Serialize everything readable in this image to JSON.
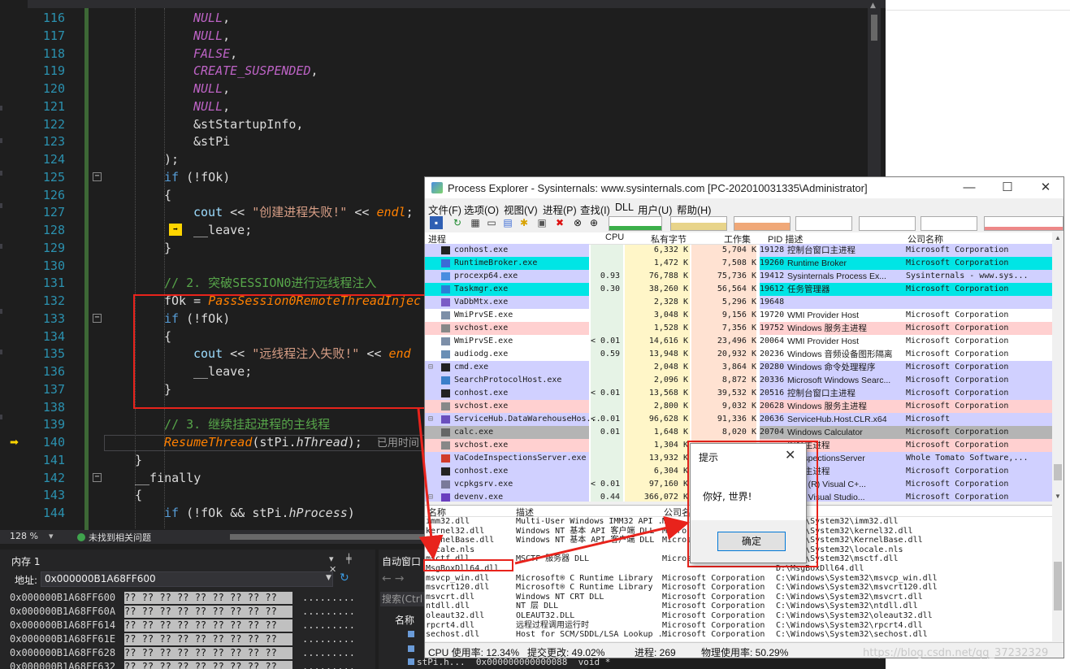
{
  "vs": {
    "lines": [
      {
        "n": "116",
        "html": "<span class='c-macro'>NULL</span>,"
      },
      {
        "n": "117",
        "html": "<span class='c-macro'>NULL</span>,"
      },
      {
        "n": "118",
        "html": "<span class='c-macro'>FALSE</span>,"
      },
      {
        "n": "119",
        "html": "<span class='c-macro'>CREATE_SUSPENDED</span>,"
      },
      {
        "n": "120",
        "html": "<span class='c-macro'>NULL</span>,"
      },
      {
        "n": "121",
        "html": "<span class='c-macro'>NULL</span>,"
      },
      {
        "n": "122",
        "html": "&amp;stStartupInfo,"
      },
      {
        "n": "123",
        "html": "&amp;stPi"
      },
      {
        "n": "124",
        "html": ");"
      },
      {
        "n": "125",
        "html": "<span class='c-kw'>if</span> (!fOk)"
      },
      {
        "n": "126",
        "html": "{"
      },
      {
        "n": "127",
        "html": "<span class='c-var'>cout</span> &lt;&lt; <span class='c-str'>\"创建进程失败!\"</span> &lt;&lt; <span class='c-fn'>endl</span>;"
      },
      {
        "n": "128",
        "html": "__leave;"
      },
      {
        "n": "129",
        "html": "}"
      },
      {
        "n": "130",
        "html": ""
      },
      {
        "n": "131",
        "html": "<span class='c-com'>// 2. 突破SESSION0进行远线程注入</span>"
      },
      {
        "n": "132",
        "html": "fOk = <span class='c-fn'>PassSession0RemoteThreadInjec</span>"
      },
      {
        "n": "133",
        "html": "<span class='c-kw'>if</span> (!fOk)"
      },
      {
        "n": "134",
        "html": "{"
      },
      {
        "n": "135",
        "html": "<span class='c-var'>cout</span> &lt;&lt; <span class='c-str'>\"远线程注入失败!\"</span> &lt;&lt; <span class='c-fn'>end</span>"
      },
      {
        "n": "136",
        "html": "__leave;"
      },
      {
        "n": "137",
        "html": "}"
      },
      {
        "n": "138",
        "html": ""
      },
      {
        "n": "139",
        "html": "<span class='c-com'>// 3. 继续挂起进程的主线程</span>"
      },
      {
        "n": "140",
        "html": "<span class='c-fn'>ResumeThread</span>(stPi.<span class='c-field'>hThread</span>);  <span class='timing'>已用时间</span>"
      },
      {
        "n": "141",
        "html": "}"
      },
      {
        "n": "142",
        "html": "__finally"
      },
      {
        "n": "143",
        "html": "{"
      },
      {
        "n": "144",
        "html": "<span class='c-kw'>if</span> (!fOk &amp;&amp; stPi.<span class='c-field'>hProcess</span>)"
      }
    ],
    "status": {
      "zoom": "128 %",
      "issues": "未找到相关问题"
    },
    "memory": {
      "title": "内存 1",
      "address_label": "地址:",
      "address": "0x000000B1A68FF600",
      "rows": [
        {
          "addr": "0x000000B1A68FF600",
          "bytes": "?? ?? ?? ?? ?? ?? ?? ?? ??",
          "ascii": "........."
        },
        {
          "addr": "0x000000B1A68FF60A",
          "bytes": "?? ?? ?? ?? ?? ?? ?? ?? ??",
          "ascii": "........."
        },
        {
          "addr": "0x000000B1A68FF614",
          "bytes": "?? ?? ?? ?? ?? ?? ?? ?? ??",
          "ascii": "........."
        },
        {
          "addr": "0x000000B1A68FF61E",
          "bytes": "?? ?? ?? ?? ?? ?? ?? ?? ??",
          "ascii": "........."
        },
        {
          "addr": "0x000000B1A68FF628",
          "bytes": "?? ?? ?? ?? ?? ?? ?? ?? ??",
          "ascii": "........."
        },
        {
          "addr": "0x000000B1A68FF632",
          "bytes": "?? ?? ?? ?? ?? ?? ?? ?? ??",
          "ascii": "........."
        }
      ]
    },
    "autos": {
      "title": "自动窗口",
      "search": "搜索(Ctrl",
      "col_name": "名称"
    },
    "debug_strip": "stPi.h...  0x000000000000088  void *"
  },
  "pe": {
    "title": "Process Explorer - Sysinternals: www.sysinternals.com [PC-202010031335\\Administrator]",
    "menu": [
      "文件(F)",
      "选项(O)",
      "视图(V)",
      "进程(P)",
      "查找(I)",
      "DLL",
      "用户(U)",
      "帮助(H)"
    ],
    "headers": {
      "process": "进程",
      "cpu": "CPU",
      "private": "私有字节",
      "working": "工作集",
      "pid_desc": "PID 描述",
      "company": "公司名称"
    },
    "rows": [
      {
        "name": "conhost.exe",
        "cpu": "",
        "priv": "6,332 K",
        "ws": "5,704 K",
        "pid": "19128",
        "desc": "控制台窗口主进程",
        "co": "Microsoft Corporation",
        "bg": "#d0d0ff",
        "tree": ""
      },
      {
        "name": "RuntimeBroker.exe",
        "cpu": "",
        "priv": "1,472 K",
        "ws": "7,508 K",
        "pid": "19260",
        "desc": "Runtime Broker",
        "co": "Microsoft Corporation",
        "bg": "#00e5e5",
        "tree": ""
      },
      {
        "name": "procexp64.exe",
        "cpu": "0.93",
        "priv": "76,788 K",
        "ws": "75,736 K",
        "pid": "19412",
        "desc": "Sysinternals Process Ex...",
        "co": "Sysinternals - www.sys...",
        "bg": "#d0d0ff",
        "tree": ""
      },
      {
        "name": "Taskmgr.exe",
        "cpu": "0.30",
        "priv": "38,260 K",
        "ws": "56,564 K",
        "pid": "19612",
        "desc": "任务管理器",
        "co": "Microsoft Corporation",
        "bg": "#00e5e5",
        "tree": ""
      },
      {
        "name": "VaDbMtx.exe",
        "cpu": "",
        "priv": "2,328 K",
        "ws": "5,296 K",
        "pid": "19648",
        "desc": "",
        "co": "",
        "bg": "#d0d0ff",
        "tree": ""
      },
      {
        "name": "WmiPrvSE.exe",
        "cpu": "",
        "priv": "3,048 K",
        "ws": "9,156 K",
        "pid": "19720",
        "desc": "WMI Provider Host",
        "co": "Microsoft Corporation",
        "bg": "#ffffff",
        "tree": ""
      },
      {
        "name": "svchost.exe",
        "cpu": "",
        "priv": "1,528 K",
        "ws": "7,356 K",
        "pid": "19752",
        "desc": "Windows 服务主进程",
        "co": "Microsoft Corporation",
        "bg": "#ffd0d0",
        "tree": ""
      },
      {
        "name": "WmiPrvSE.exe",
        "cpu": "< 0.01",
        "priv": "14,616 K",
        "ws": "23,496 K",
        "pid": "20064",
        "desc": "WMI Provider Host",
        "co": "Microsoft Corporation",
        "bg": "#ffffff",
        "tree": ""
      },
      {
        "name": "audiodg.exe",
        "cpu": "0.59",
        "priv": "13,948 K",
        "ws": "20,932 K",
        "pid": "20236",
        "desc": "Windows 音频设备图形隔离",
        "co": "Microsoft Corporation",
        "bg": "#ffffff",
        "tree": ""
      },
      {
        "name": "cmd.exe",
        "cpu": "",
        "priv": "2,048 K",
        "ws": "3,864 K",
        "pid": "20280",
        "desc": "Windows 命令处理程序",
        "co": "Microsoft Corporation",
        "bg": "#d0d0ff",
        "tree": "⊟"
      },
      {
        "name": "SearchProtocolHost.exe",
        "cpu": "",
        "priv": "2,096 K",
        "ws": "8,872 K",
        "pid": "20336",
        "desc": "Microsoft Windows Searc...",
        "co": "Microsoft Corporation",
        "bg": "#d0d0ff",
        "tree": ""
      },
      {
        "name": "conhost.exe",
        "cpu": "< 0.01",
        "priv": "13,568 K",
        "ws": "39,532 K",
        "pid": "20516",
        "desc": "控制台窗口主进程",
        "co": "Microsoft Corporation",
        "bg": "#d0d0ff",
        "tree": ""
      },
      {
        "name": "svchost.exe",
        "cpu": "",
        "priv": "2,800 K",
        "ws": "9,032 K",
        "pid": "20628",
        "desc": "Windows 服务主进程",
        "co": "Microsoft Corporation",
        "bg": "#ffd0d0",
        "tree": ""
      },
      {
        "name": "ServiceHub.DataWarehouseHos...",
        "cpu": "< 0.01",
        "priv": "96,628 K",
        "ws": "91,336 K",
        "pid": "20636",
        "desc": "ServiceHub.Host.CLR.x64",
        "co": "Microsoft",
        "bg": "#d0d0ff",
        "tree": "⊟"
      },
      {
        "name": "calc.exe",
        "cpu": "0.01",
        "priv": "1,648 K",
        "ws": "8,020 K",
        "pid": "20704",
        "desc": "Windows Calculator",
        "co": "Microsoft Corporation",
        "bg": "#b4b4b4",
        "tree": ""
      },
      {
        "name": "svchost.exe",
        "cpu": "",
        "priv": "1,304 K",
        "ws": "",
        "pid": "",
        "desc": "服务主进程",
        "co": "Microsoft Corporation",
        "bg": "#ffd0d0",
        "tree": ""
      },
      {
        "name": "VaCodeInspectionsServer.exe",
        "cpu": "",
        "priv": "13,932 K",
        "ws": "",
        "pid": "",
        "desc": "deInspectionsServer",
        "co": "Whole Tomato Software,...",
        "bg": "#d0d0ff",
        "tree": ""
      },
      {
        "name": "conhost.exe",
        "cpu": "",
        "priv": "6,304 K",
        "ws": "",
        "pid": "",
        "desc": "窗口主进程",
        "co": "Microsoft Corporation",
        "bg": "#d0d0ff",
        "tree": ""
      },
      {
        "name": "vcpkgsrv.exe",
        "cpu": "< 0.01",
        "priv": "97,160 K",
        "ws": "",
        "pid": "",
        "desc": "osoft (R) Visual C+...",
        "co": "Microsoft Corporation",
        "bg": "#d0d0ff",
        "tree": ""
      },
      {
        "name": "devenv.exe",
        "cpu": "0.44",
        "priv": "366,072 K",
        "ws": "",
        "pid": "",
        "desc": "osoft Visual Studio...",
        "co": "Microsoft Corporation",
        "bg": "#d0d0ff",
        "tree": "⊟"
      }
    ],
    "dll_headers": {
      "name": "名称",
      "desc": "描述",
      "company": "公司名"
    },
    "dlls": [
      {
        "name": "imm32.dll",
        "desc": "Multi-User Windows IMM32 API ...",
        "co": "M",
        "path": "indows\\System32\\imm32.dll"
      },
      {
        "name": "kernel32.dll",
        "desc": "Windows NT 基本 API 客户端 DLL",
        "co": "Micro",
        "path": "indows\\System32\\kernel32.dll"
      },
      {
        "name": "KernelBase.dll",
        "desc": "Windows NT 基本 API 客户端 DLL",
        "co": "Micros",
        "path": "indows\\System32\\KernelBase.dll"
      },
      {
        "name": "locale.nls",
        "desc": "",
        "co": "",
        "path": "indows\\System32\\locale.nls"
      },
      {
        "name": "msctf.dll",
        "desc": "MSCTF 服务器 DLL",
        "co": "Micros",
        "path": "indows\\System32\\msctf.dll"
      },
      {
        "name": "MsgBoxDll64.dll",
        "desc": "",
        "co": "",
        "path": "D:\\MsgBoxDll64.dll"
      },
      {
        "name": "msvcp_win.dll",
        "desc": "Microsoft® C Runtime Library",
        "co": "Microsoft Corporation",
        "path": "C:\\Windows\\System32\\msvcp_win.dll"
      },
      {
        "name": "msvcrt120.dll",
        "desc": "Microsoft® C Runtime Library",
        "co": "Microsoft Corporation",
        "path": "C:\\Windows\\System32\\msvcrt120.dll"
      },
      {
        "name": "msvcrt.dll",
        "desc": "Windows NT CRT DLL",
        "co": "Microsoft Corporation",
        "path": "C:\\Windows\\System32\\msvcrt.dll"
      },
      {
        "name": "ntdll.dll",
        "desc": "NT 层 DLL",
        "co": "Microsoft Corporation",
        "path": "C:\\Windows\\System32\\ntdll.dll"
      },
      {
        "name": "oleaut32.dll",
        "desc": "OLEAUT32.DLL",
        "co": "Microsoft Corporation",
        "path": "C:\\Windows\\System32\\oleaut32.dll"
      },
      {
        "name": "rpcrt4.dll",
        "desc": "远程过程调用运行时",
        "co": "Microsoft Corporation",
        "path": "C:\\Windows\\System32\\rpcrt4.dll"
      },
      {
        "name": "sechost.dll",
        "desc": "Host for SCM/SDDL/LSA Lookup ...",
        "co": "Microsoft Corporation",
        "path": "C:\\Windows\\System32\\sechost.dll"
      }
    ],
    "status": {
      "cpu": "CPU 使用率: 12.34%",
      "commit": "提交更改: 49.02%",
      "procs": "进程: 269",
      "phys": "物理使用率: 50.29%"
    }
  },
  "msgbox": {
    "title": "提示",
    "text": "你好, 世界!",
    "ok": "确定"
  },
  "watermark": "https://blog.csdn.net/qq_37232329",
  "colors": {
    "annotation_red": "#e8231c",
    "vs_bg": "#1e1e1e"
  }
}
